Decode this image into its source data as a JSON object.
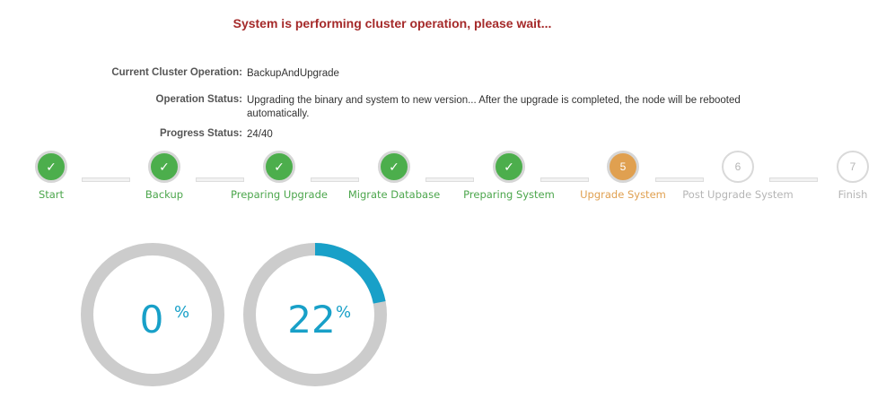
{
  "banner": "System is performing cluster operation, please wait...",
  "info": [
    {
      "label": "Current Cluster Operation:",
      "value": "BackupAndUpgrade"
    },
    {
      "label": "Operation Status:",
      "value": "Upgrading the binary and system to new version... After the upgrade is completed, the node will be rebooted automatically."
    },
    {
      "label": "Progress Status:",
      "value": "24/40"
    }
  ],
  "steps": [
    {
      "label": "Start",
      "state": "done",
      "symbol": "✓"
    },
    {
      "label": "Backup",
      "state": "done",
      "symbol": "✓"
    },
    {
      "label": "Preparing Upgrade",
      "state": "done",
      "symbol": "✓"
    },
    {
      "label": "Migrate Database",
      "state": "done",
      "symbol": "✓"
    },
    {
      "label": "Preparing System",
      "state": "done",
      "symbol": "✓"
    },
    {
      "label": "Upgrade System",
      "state": "active",
      "symbol": "5"
    },
    {
      "label": "Post Upgrade System",
      "state": "pending",
      "symbol": "6"
    },
    {
      "label": "Finish",
      "state": "pending",
      "symbol": "7"
    }
  ],
  "gauges": [
    {
      "value": "0",
      "unit": "%",
      "fraction": 0.0
    },
    {
      "value": "22",
      "unit": "%",
      "fraction": 0.22
    }
  ],
  "colors": {
    "banner": "#a52a2a",
    "done": "#4cae4c",
    "active": "#e0a050",
    "pending": "#b5b5b5",
    "gauge_track": "#cccccc",
    "gauge_fill": "#18a0c8"
  }
}
